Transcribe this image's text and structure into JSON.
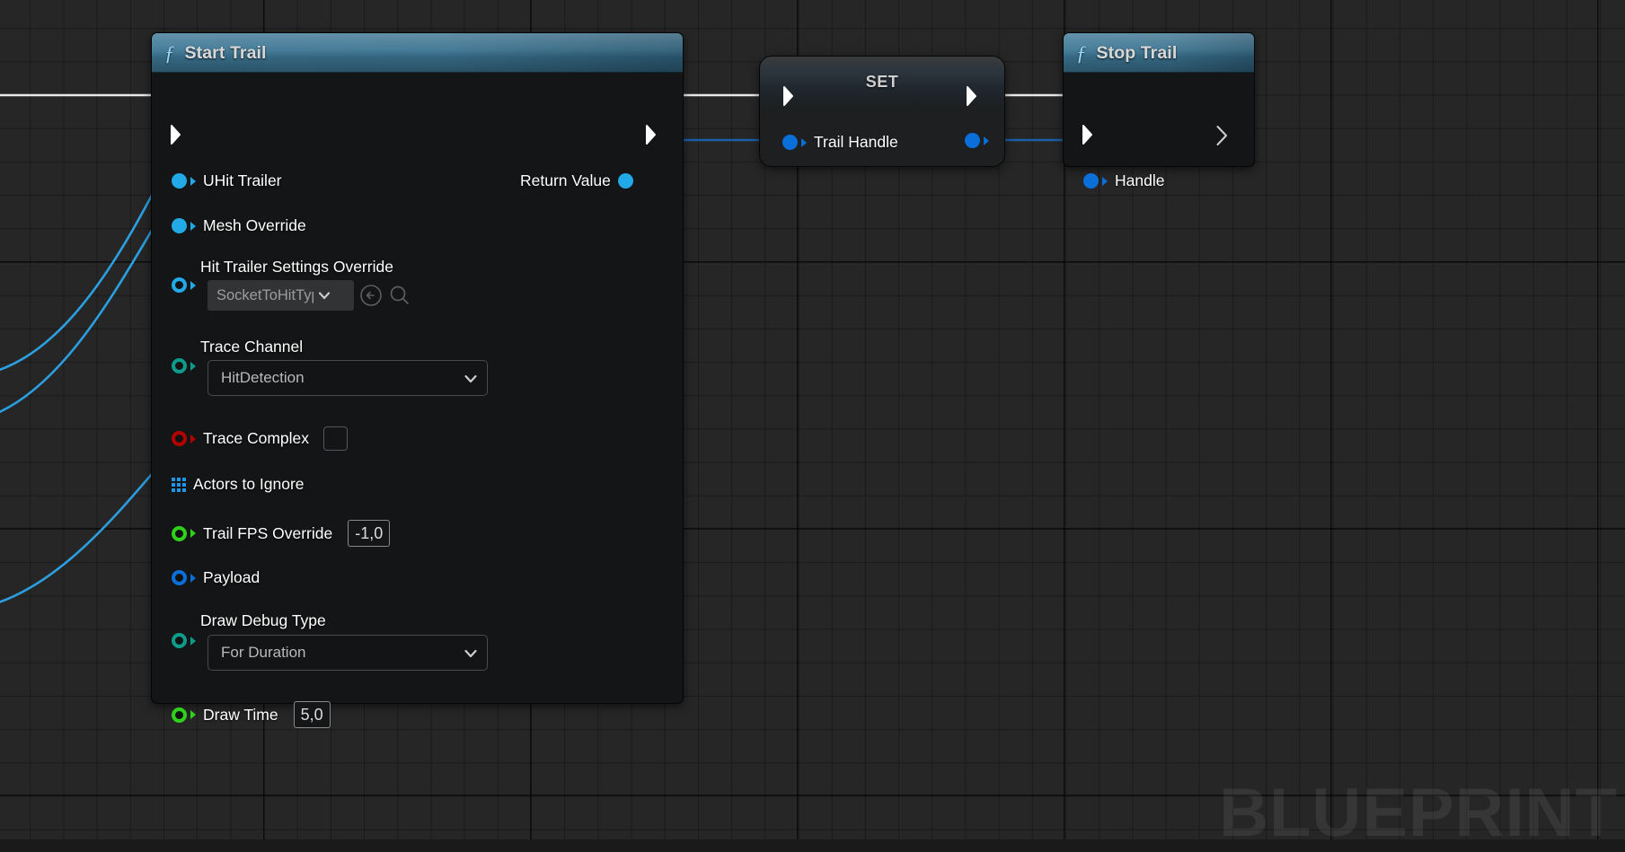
{
  "canvas": {
    "watermark": "BLUEPRINT",
    "grid_color": "#262626"
  },
  "colors": {
    "exec_white": "#ffffff",
    "object_blue": "#22a9e8",
    "struct_blue": "#0a6fd8",
    "enum_teal": "#0d9b8a",
    "bool_red": "#b30000",
    "float_green": "#2fd11a",
    "array_blue": "#2196e8",
    "fn_header_blue": "#3b7390",
    "wire_white": "#e8e8e8",
    "wire_blue": "#2b9fe0",
    "wire_darkblue": "#1b5fa8"
  },
  "nodes": [
    {
      "id": "start-trail",
      "type": "function",
      "title": "Start Trail",
      "icon": "function-f-icon",
      "inputs": [
        {
          "name": "exec-in",
          "label": "",
          "pin": "exec"
        },
        {
          "name": "UHit Trailer",
          "label": "UHit Trailer",
          "pin": "object"
        },
        {
          "name": "Mesh Override",
          "label": "Mesh Override",
          "pin": "object"
        },
        {
          "name": "Hit Trailer Settings Override",
          "label": "Hit Trailer Settings Override",
          "pin": "struct-ring-blue",
          "widget": {
            "kind": "combo-small",
            "value": "SocketToHitTypi",
            "buttons": [
              "back-arrow-icon",
              "search-icon"
            ]
          }
        },
        {
          "name": "Trace Channel",
          "label": "Trace Channel",
          "pin": "enum-ring-teal",
          "widget": {
            "kind": "combo",
            "value": "HitDetection"
          }
        },
        {
          "name": "Trace Complex",
          "label": "Trace Complex",
          "pin": "bool-ring-red",
          "widget": {
            "kind": "checkbox",
            "checked": false
          }
        },
        {
          "name": "Actors to Ignore",
          "label": "Actors to Ignore",
          "pin": "array"
        },
        {
          "name": "Trail FPS Override",
          "label": "Trail FPS Override",
          "pin": "float-ring-green",
          "widget": {
            "kind": "number",
            "value": "-1,0"
          }
        },
        {
          "name": "Payload",
          "label": "Payload",
          "pin": "struct-ring-darkblue"
        },
        {
          "name": "Draw Debug Type",
          "label": "Draw Debug Type",
          "pin": "enum-ring-teal",
          "widget": {
            "kind": "combo",
            "value": "For Duration"
          }
        },
        {
          "name": "Draw Time",
          "label": "Draw Time",
          "pin": "float-ring-green",
          "widget": {
            "kind": "number",
            "value": "5,0"
          }
        }
      ],
      "outputs": [
        {
          "name": "exec-out",
          "label": "",
          "pin": "exec"
        },
        {
          "name": "Return Value",
          "label": "Return Value",
          "pin": "object"
        }
      ]
    },
    {
      "id": "set-trail-handle",
      "type": "set",
      "title": "SET",
      "inputs": [
        {
          "name": "exec-in",
          "label": "",
          "pin": "exec"
        },
        {
          "name": "Trail Handle",
          "label": "Trail Handle",
          "pin": "struct-dot-blue"
        }
      ],
      "outputs": [
        {
          "name": "exec-out",
          "label": "",
          "pin": "exec"
        },
        {
          "name": "Trail Handle Out",
          "label": "",
          "pin": "struct-dot-blue"
        }
      ]
    },
    {
      "id": "stop-trail",
      "type": "function",
      "title": "Stop Trail",
      "icon": "function-f-icon",
      "inputs": [
        {
          "name": "exec-in",
          "label": "",
          "pin": "exec"
        },
        {
          "name": "Handle",
          "label": "Handle",
          "pin": "struct-dot-blue"
        }
      ],
      "outputs": [
        {
          "name": "exec-out",
          "label": "",
          "pin": "exec-hollow"
        }
      ]
    }
  ]
}
